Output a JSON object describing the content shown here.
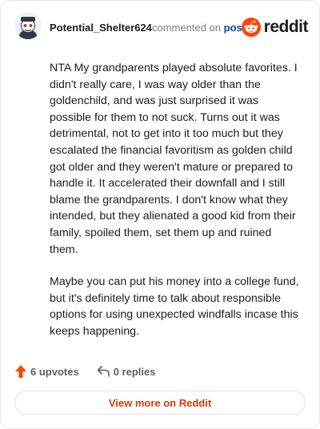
{
  "comment": {
    "username": "Potential_Shelter624",
    "action_text": "commented on",
    "post_link": "post",
    "paragraphs": [
      "NTA My grandparents played absolute favorites. I didn't really care, I was way older than the goldenchild, and was just surprised it was possible for them to not suck. Turns out it was detrimental, not to get into it too much but they escalated the financial favoritism as golden child got older and they weren't mature or prepared to handle it. It accelerated their downfall and I still blame the grandparents. I don't know what they intended, but they alienated a good kid from their family, spoiled them, set them up and ruined them.",
      "Maybe you can put his money into a college fund, but it's definitely time to talk about responsible options for using unexpected windfalls incase this keeps happening."
    ],
    "upvotes_label": "6 upvotes",
    "replies_label": "0 replies"
  },
  "brand": {
    "name": "reddit",
    "color": "#ff4500"
  },
  "footer": {
    "view_more_label": "View more on Reddit"
  },
  "icons": {
    "avatar": "snoo-avatar-icon",
    "logo": "reddit-logo-icon",
    "upvote": "upvote-arrow-icon",
    "reply": "reply-arrow-icon"
  }
}
